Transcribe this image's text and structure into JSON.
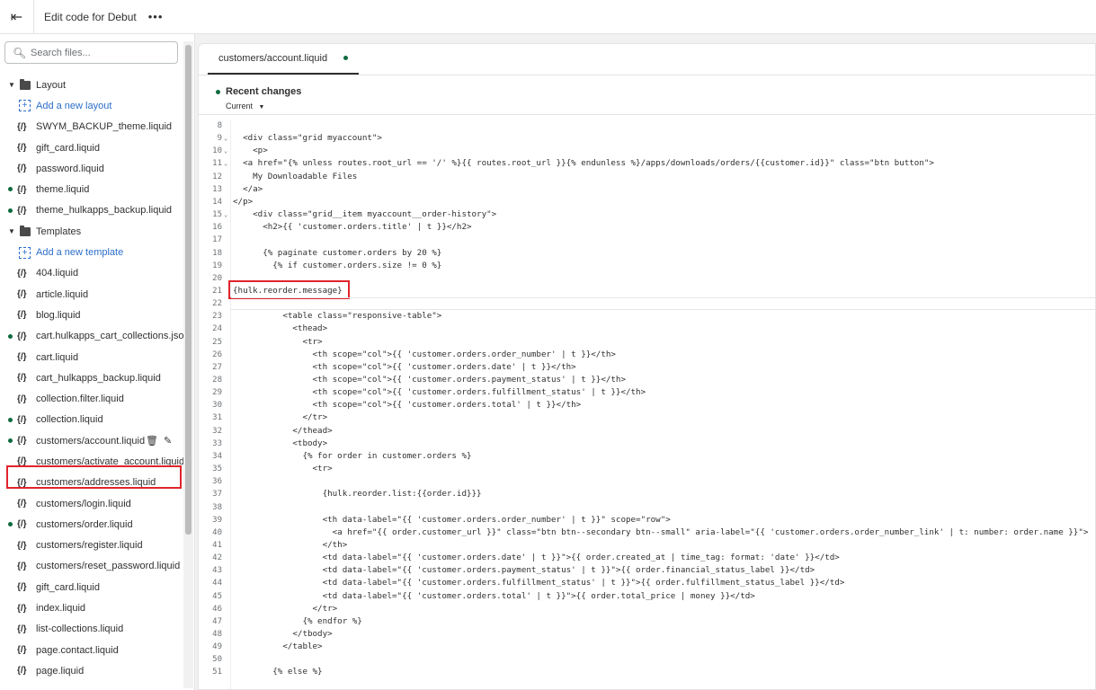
{
  "topbar": {
    "title": "Edit code for Debut",
    "more_label": "•••"
  },
  "search": {
    "placeholder": "Search files..."
  },
  "sidebar": {
    "sections": [
      {
        "type": "folder",
        "label": "Layout"
      },
      {
        "type": "add",
        "label": "Add a new layout"
      },
      {
        "type": "file",
        "label": "SWYM_BACKUP_theme.liquid",
        "modified": false
      },
      {
        "type": "file",
        "label": "gift_card.liquid",
        "modified": false
      },
      {
        "type": "file",
        "label": "password.liquid",
        "modified": false
      },
      {
        "type": "file",
        "label": "theme.liquid",
        "modified": true
      },
      {
        "type": "file",
        "label": "theme_hulkapps_backup.liquid",
        "modified": true
      },
      {
        "type": "folder",
        "label": "Templates"
      },
      {
        "type": "add",
        "label": "Add a new template"
      },
      {
        "type": "file",
        "label": "404.liquid",
        "modified": false
      },
      {
        "type": "file",
        "label": "article.liquid",
        "modified": false
      },
      {
        "type": "file",
        "label": "blog.liquid",
        "modified": false
      },
      {
        "type": "file",
        "label": "cart.hulkapps_cart_collections.jso...",
        "modified": true
      },
      {
        "type": "file",
        "label": "cart.liquid",
        "modified": false
      },
      {
        "type": "file",
        "label": "cart_hulkapps_backup.liquid",
        "modified": false
      },
      {
        "type": "file",
        "label": "collection.filter.liquid",
        "modified": false
      },
      {
        "type": "file",
        "label": "collection.liquid",
        "modified": true
      },
      {
        "type": "file",
        "label": "customers/account.liquid",
        "modified": true,
        "selected": true
      },
      {
        "type": "file",
        "label": "customers/activate_account.liquid",
        "modified": false
      },
      {
        "type": "file",
        "label": "customers/addresses.liquid",
        "modified": false
      },
      {
        "type": "file",
        "label": "customers/login.liquid",
        "modified": false
      },
      {
        "type": "file",
        "label": "customers/order.liquid",
        "modified": true
      },
      {
        "type": "file",
        "label": "customers/register.liquid",
        "modified": false
      },
      {
        "type": "file",
        "label": "customers/reset_password.liquid",
        "modified": false
      },
      {
        "type": "file",
        "label": "gift_card.liquid",
        "modified": false
      },
      {
        "type": "file",
        "label": "index.liquid",
        "modified": false
      },
      {
        "type": "file",
        "label": "list-collections.liquid",
        "modified": false
      },
      {
        "type": "file",
        "label": "page.contact.liquid",
        "modified": false
      },
      {
        "type": "file",
        "label": "page.liquid",
        "modified": false
      }
    ],
    "file_icon": "{/}"
  },
  "editor": {
    "tab_label": "customers/account.liquid",
    "recent_label": "Recent changes",
    "version_select": "Current",
    "current_line": 22,
    "highlight_line": 21,
    "lines": [
      {
        "n": "8",
        "fold": false,
        "text": ""
      },
      {
        "n": "9",
        "fold": true,
        "text": "  <div class=\"grid myaccount\">"
      },
      {
        "n": "10",
        "fold": true,
        "text": "    <p>"
      },
      {
        "n": "11",
        "fold": true,
        "text": "  <a href=\"{% unless routes.root_url == '/' %}{{ routes.root_url }}{% endunless %}/apps/downloads/orders/{{customer.id}}\" class=\"btn button\">"
      },
      {
        "n": "12",
        "fold": false,
        "text": "    My Downloadable Files"
      },
      {
        "n": "13",
        "fold": false,
        "text": "  </a>"
      },
      {
        "n": "14",
        "fold": false,
        "text": "</p>"
      },
      {
        "n": "15",
        "fold": true,
        "text": "    <div class=\"grid__item myaccount__order-history\">"
      },
      {
        "n": "16",
        "fold": false,
        "text": "      <h2>{{ 'customer.orders.title' | t }}</h2>"
      },
      {
        "n": "17",
        "fold": false,
        "text": ""
      },
      {
        "n": "18",
        "fold": false,
        "text": "      {% paginate customer.orders by 20 %}"
      },
      {
        "n": "19",
        "fold": false,
        "text": "        {% if customer.orders.size != 0 %}"
      },
      {
        "n": "20",
        "fold": false,
        "text": ""
      },
      {
        "n": "21",
        "fold": false,
        "text": "{hulk.reorder.message}"
      },
      {
        "n": "22",
        "fold": false,
        "text": ""
      },
      {
        "n": "23",
        "fold": false,
        "text": "          <table class=\"responsive-table\">"
      },
      {
        "n": "24",
        "fold": false,
        "text": "            <thead>"
      },
      {
        "n": "25",
        "fold": false,
        "text": "              <tr>"
      },
      {
        "n": "26",
        "fold": false,
        "text": "                <th scope=\"col\">{{ 'customer.orders.order_number' | t }}</th>"
      },
      {
        "n": "27",
        "fold": false,
        "text": "                <th scope=\"col\">{{ 'customer.orders.date' | t }}</th>"
      },
      {
        "n": "28",
        "fold": false,
        "text": "                <th scope=\"col\">{{ 'customer.orders.payment_status' | t }}</th>"
      },
      {
        "n": "29",
        "fold": false,
        "text": "                <th scope=\"col\">{{ 'customer.orders.fulfillment_status' | t }}</th>"
      },
      {
        "n": "30",
        "fold": false,
        "text": "                <th scope=\"col\">{{ 'customer.orders.total' | t }}</th>"
      },
      {
        "n": "31",
        "fold": false,
        "text": "              </tr>"
      },
      {
        "n": "32",
        "fold": false,
        "text": "            </thead>"
      },
      {
        "n": "33",
        "fold": false,
        "text": "            <tbody>"
      },
      {
        "n": "34",
        "fold": false,
        "text": "              {% for order in customer.orders %}"
      },
      {
        "n": "35",
        "fold": false,
        "text": "                <tr>"
      },
      {
        "n": "36",
        "fold": false,
        "text": ""
      },
      {
        "n": "37",
        "fold": false,
        "text": "                  {hulk.reorder.list:{{order.id}}}"
      },
      {
        "n": "38",
        "fold": false,
        "text": ""
      },
      {
        "n": "39",
        "fold": false,
        "text": "                  <th data-label=\"{{ 'customer.orders.order_number' | t }}\" scope=\"row\">"
      },
      {
        "n": "40",
        "fold": false,
        "text": "                    <a href=\"{{ order.customer_url }}\" class=\"btn btn--secondary btn--small\" aria-label=\"{{ 'customer.orders.order_number_link' | t: number: order.name }}\">"
      },
      {
        "n": "41",
        "fold": false,
        "text": "                  </th>"
      },
      {
        "n": "42",
        "fold": false,
        "text": "                  <td data-label=\"{{ 'customer.orders.date' | t }}\">{{ order.created_at | time_tag: format: 'date' }}</td>"
      },
      {
        "n": "43",
        "fold": false,
        "text": "                  <td data-label=\"{{ 'customer.orders.payment_status' | t }}\">{{ order.financial_status_label }}</td>"
      },
      {
        "n": "44",
        "fold": false,
        "text": "                  <td data-label=\"{{ 'customer.orders.fulfillment_status' | t }}\">{{ order.fulfillment_status_label }}</td>"
      },
      {
        "n": "45",
        "fold": false,
        "text": "                  <td data-label=\"{{ 'customer.orders.total' | t }}\">{{ order.total_price | money }}</td>"
      },
      {
        "n": "46",
        "fold": false,
        "text": "                </tr>"
      },
      {
        "n": "47",
        "fold": false,
        "text": "              {% endfor %}"
      },
      {
        "n": "48",
        "fold": false,
        "text": "            </tbody>"
      },
      {
        "n": "49",
        "fold": false,
        "text": "          </table>"
      },
      {
        "n": "50",
        "fold": false,
        "text": ""
      },
      {
        "n": "51",
        "fold": false,
        "text": "        {% else %}"
      }
    ]
  },
  "colors": {
    "modified_dot": "#0e6a3f",
    "highlight": "#e0242c",
    "link": "#2c6ecb",
    "string": "#b3203b"
  }
}
